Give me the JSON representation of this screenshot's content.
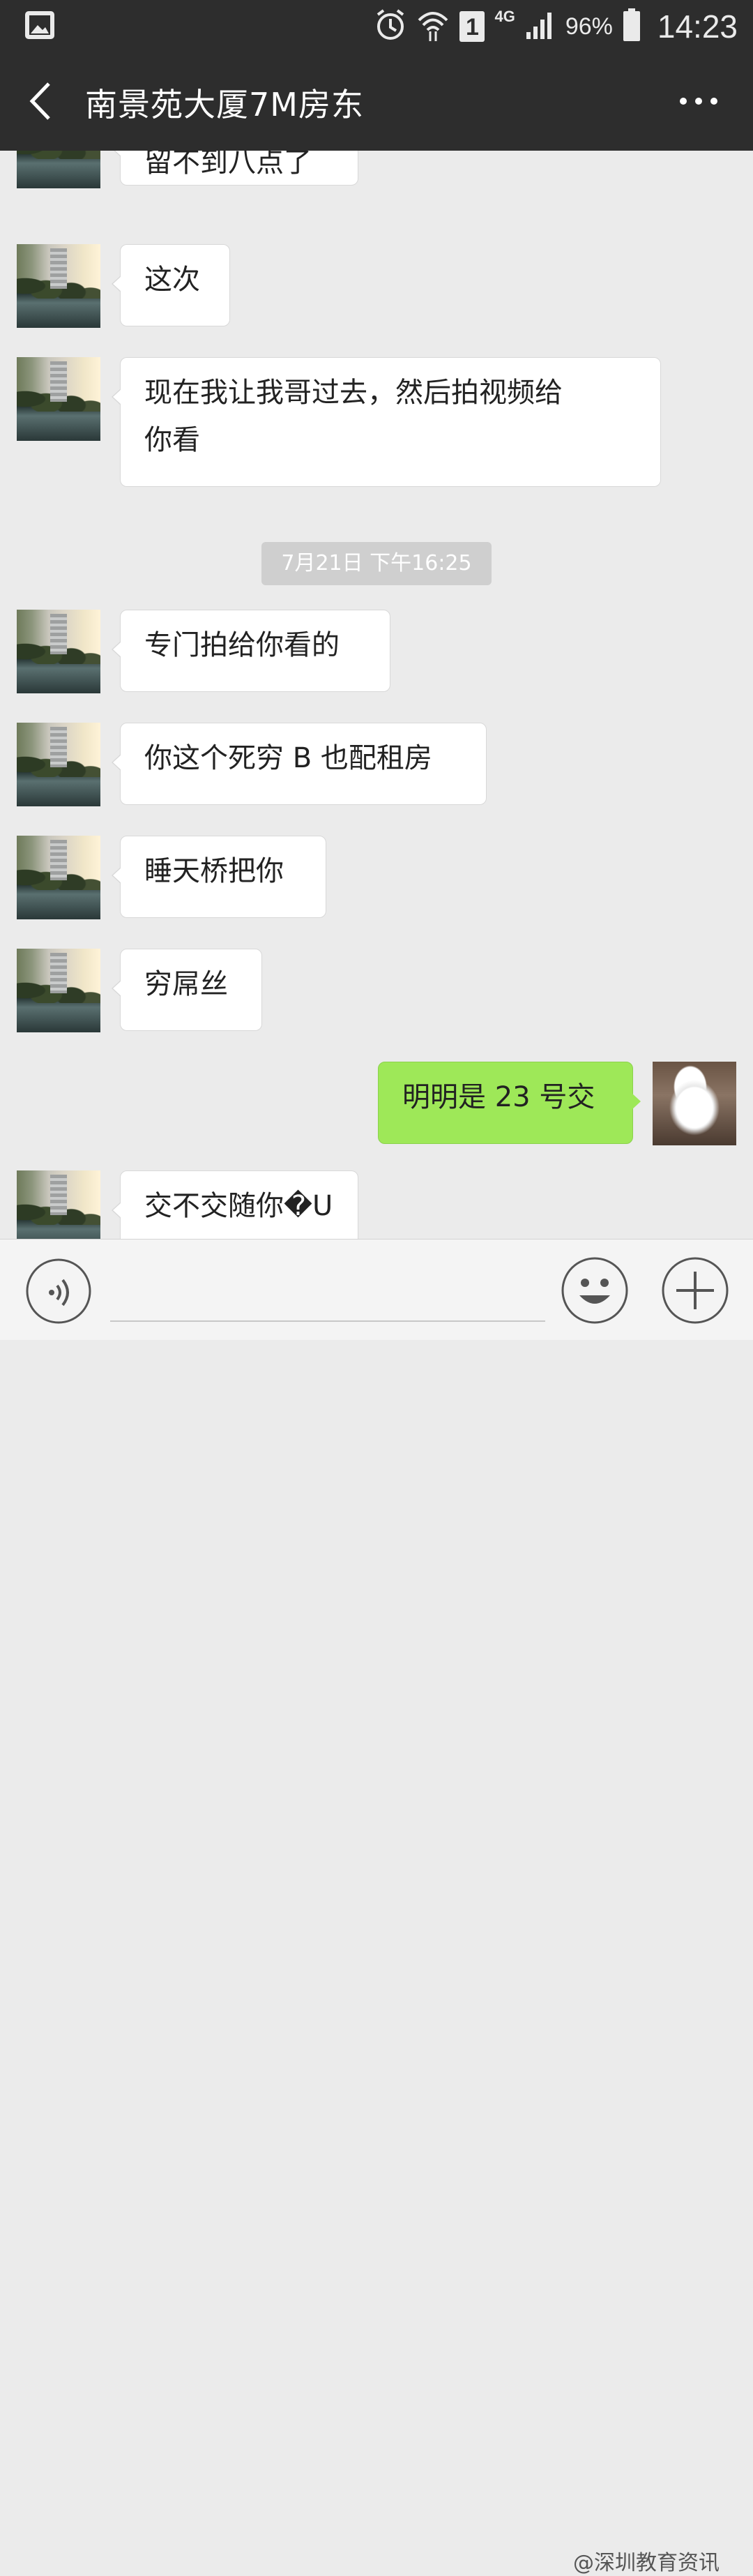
{
  "status_bar": {
    "signal_type": "4G",
    "sim_number": "1",
    "battery": "96%",
    "time": "14:23"
  },
  "header": {
    "title": "南景苑大厦7M房东"
  },
  "messages": [
    {
      "sender": "landlord",
      "text": "留不到八点了"
    },
    {
      "sender": "landlord",
      "text": "这次"
    },
    {
      "sender": "landlord",
      "text_line1": "现在我让我哥过去，然后拍视频给",
      "text_line2": "你看"
    },
    {
      "timestamp": "7月21日 下午16:25"
    },
    {
      "sender": "landlord",
      "text": "专门拍给你看的"
    },
    {
      "sender": "landlord",
      "text": "你这个死穷 B 也配租房"
    },
    {
      "sender": "landlord",
      "text": "睡天桥把你"
    },
    {
      "sender": "landlord",
      "text": "穷屌丝"
    },
    {
      "sender": "me",
      "text": "明明是 23 号交"
    },
    {
      "sender": "landlord",
      "text": "交不交随你�U"
    }
  ],
  "watermark": "@深圳教育资讯",
  "icons": {
    "back": "back-arrow-icon",
    "more": "more-dots-icon",
    "voice": "voice-icon",
    "emoji": "emoji-icon",
    "plus": "plus-icon"
  },
  "colors": {
    "header_bg": "#2d2d2d",
    "chat_bg": "#ebebeb",
    "outgoing_bubble": "#9ee858",
    "incoming_bubble": "#ffffff"
  }
}
